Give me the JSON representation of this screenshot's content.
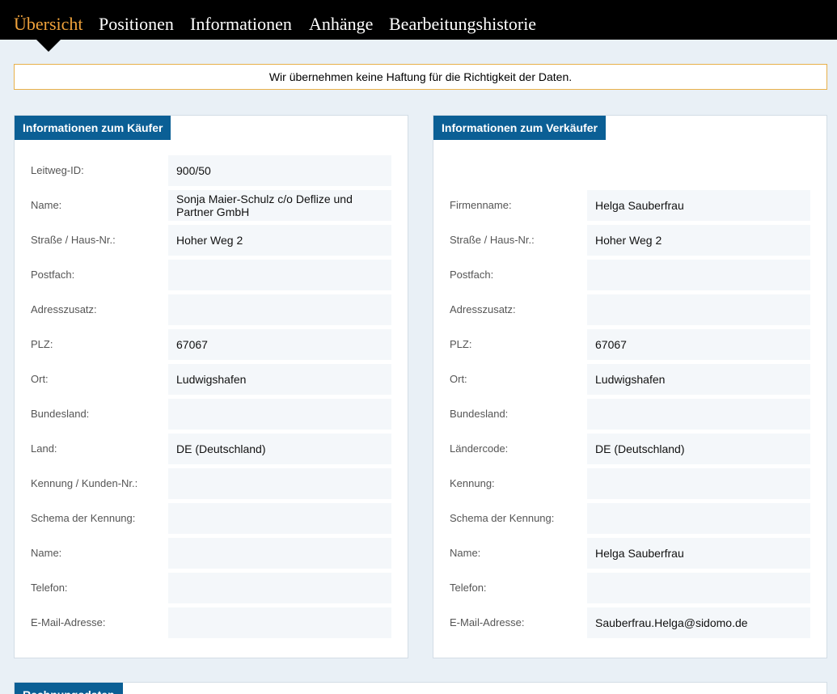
{
  "nav": {
    "tabs": [
      {
        "label": "Übersicht",
        "active": true
      },
      {
        "label": "Positionen",
        "active": false
      },
      {
        "label": "Informationen",
        "active": false
      },
      {
        "label": "Anhänge",
        "active": false
      },
      {
        "label": "Bearbeitungshistorie",
        "active": false
      }
    ]
  },
  "notice": "Wir übernehmen keine Haftung für die Richtigkeit der Daten.",
  "buyer": {
    "title": "Informationen zum Käufer",
    "rows": [
      {
        "label": "Leitweg-ID:",
        "value": "900/50"
      },
      {
        "label": "Name:",
        "value": "Sonja Maier-Schulz c/o Deflize und Partner GmbH"
      },
      {
        "label": "Straße / Haus-Nr.:",
        "value": "Hoher Weg 2"
      },
      {
        "label": "Postfach:",
        "value": ""
      },
      {
        "label": "Adresszusatz:",
        "value": ""
      },
      {
        "label": "PLZ:",
        "value": "67067"
      },
      {
        "label": "Ort:",
        "value": "Ludwigshafen"
      },
      {
        "label": "Bundesland:",
        "value": ""
      },
      {
        "label": "Land:",
        "value": "DE (Deutschland)"
      },
      {
        "label": "Kennung / Kunden-Nr.:",
        "value": ""
      },
      {
        "label": "Schema der Kennung:",
        "value": ""
      },
      {
        "label": "Name:",
        "value": ""
      },
      {
        "label": "Telefon:",
        "value": ""
      },
      {
        "label": "E-Mail-Adresse:",
        "value": ""
      }
    ]
  },
  "seller": {
    "title": "Informationen zum Verkäufer",
    "rows": [
      {
        "label": "Firmenname:",
        "value": "Helga Sauberfrau"
      },
      {
        "label": "Straße / Haus-Nr.:",
        "value": "Hoher Weg 2"
      },
      {
        "label": "Postfach:",
        "value": ""
      },
      {
        "label": "Adresszusatz:",
        "value": ""
      },
      {
        "label": "PLZ:",
        "value": "67067"
      },
      {
        "label": "Ort:",
        "value": "Ludwigshafen"
      },
      {
        "label": "Bundesland:",
        "value": ""
      },
      {
        "label": "Ländercode:",
        "value": "DE (Deutschland)"
      },
      {
        "label": "Kennung:",
        "value": ""
      },
      {
        "label": "Schema der Kennung:",
        "value": ""
      },
      {
        "label": "Name:",
        "value": "Helga Sauberfrau"
      },
      {
        "label": "Telefon:",
        "value": ""
      },
      {
        "label": "E-Mail-Adresse:",
        "value": "Sauberfrau.Helga@sidomo.de"
      }
    ]
  },
  "next_section": {
    "title": "Rechnungsdaten"
  },
  "colors": {
    "nav_bg": "#000000",
    "active_tab": "#f0a23b",
    "panel_header": "#0b5f95",
    "notice_border": "#e8b04a",
    "page_bg": "#e9f0f6"
  }
}
